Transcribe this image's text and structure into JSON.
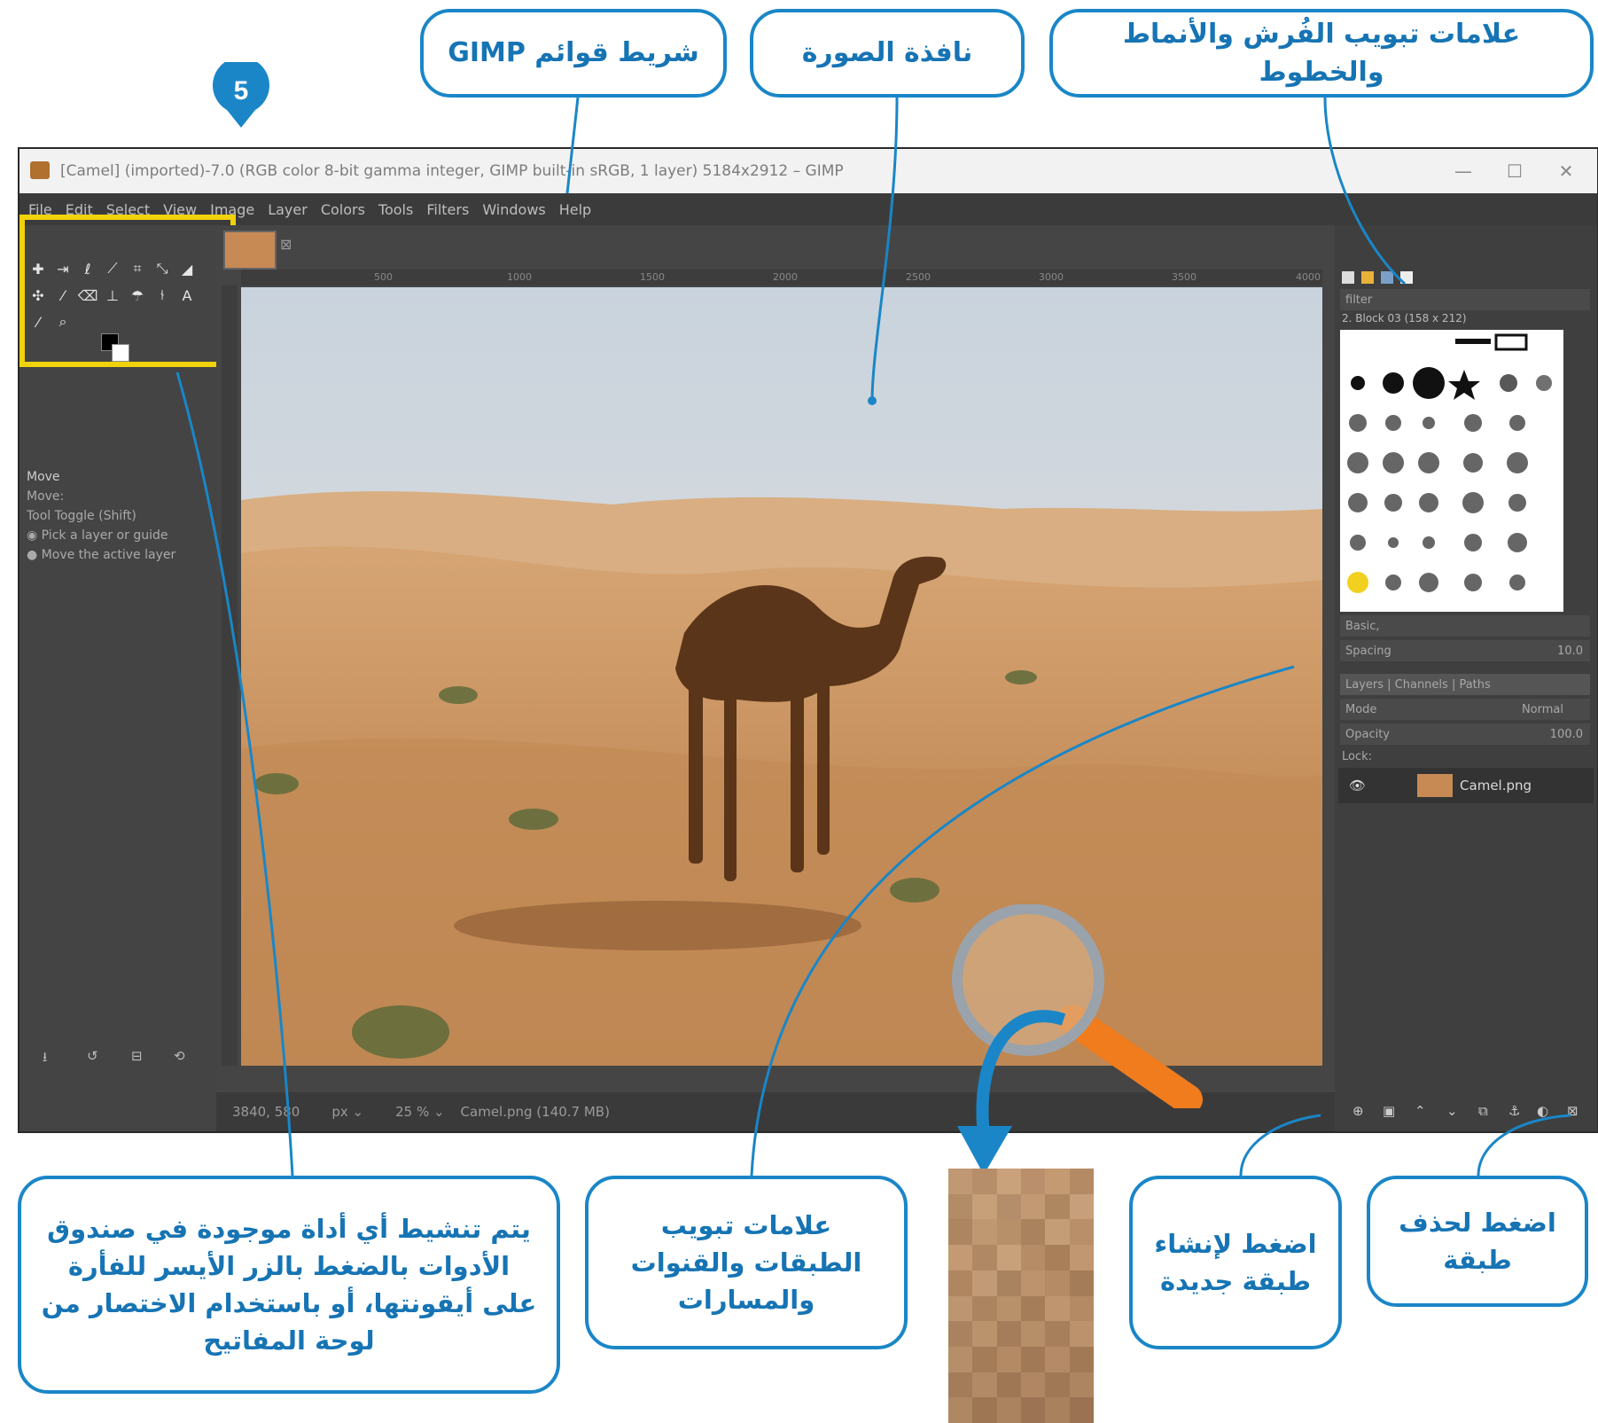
{
  "step_number": "5",
  "callouts": {
    "menubar": "شريط قوائم GIMP",
    "image_window": "نافذة الصورة",
    "brushes_tabs": "علامات تبويب الفُرش والأنماط والخطوط",
    "toolbox_note": "يتم تنشيط أي أداة موجودة في صندوق الأدوات بالضغط بالزر الأيسر للفأرة على أيقونتها، أو باستخدام الاختصار من لوحة المفاتيح",
    "layers_tabs": "علامات تبويب الطبقات والقنوات والمسارات",
    "new_layer": "اضغط لإنشاء طبقة جديدة",
    "delete_layer": "اضغط لحذف طبقة"
  },
  "window": {
    "title": "[Camel] (imported)-7.0 (RGB color 8-bit gamma integer, GIMP built-in sRGB, 1 layer) 5184x2912 – GIMP",
    "controls": {
      "minimize": "—",
      "maximize": "☐",
      "close": "✕"
    }
  },
  "menubar": [
    "File",
    "Edit",
    "Select",
    "View",
    "Image",
    "Layer",
    "Colors",
    "Tools",
    "Filters",
    "Windows",
    "Help"
  ],
  "tool_options": {
    "title": "Move",
    "move_label": "Move:",
    "toggle": "Tool Toggle (Shift)",
    "option1": "Pick a layer or guide",
    "option2": "Move the active layer"
  },
  "ruler_marks": [
    "500",
    "1000",
    "1500",
    "2000",
    "2500",
    "3000",
    "3500",
    "4000"
  ],
  "statusbar": {
    "coords": "3840, 580",
    "unit": "px",
    "zoom": "25 %",
    "file": "Camel.png (140.7 MB)"
  },
  "right_dock": {
    "filter": "filter",
    "brush_name": "2. Block 03 (158 x 212)",
    "preset": "Basic,",
    "spacing_label": "Spacing",
    "spacing_value": "10.0",
    "tabs": "Layers | Channels | Paths",
    "mode_label": "Mode",
    "mode_value": "Normal",
    "opacity_label": "Opacity",
    "opacity_value": "100.0",
    "lock_label": "Lock:",
    "layer_name": "Camel.png"
  },
  "colors": {
    "callout_border": "#1a86c7",
    "callout_text": "#1674b4",
    "highlight": "#f2d20a",
    "gimp_bg": "#454545",
    "magnifier_handle": "#f07c1e"
  }
}
